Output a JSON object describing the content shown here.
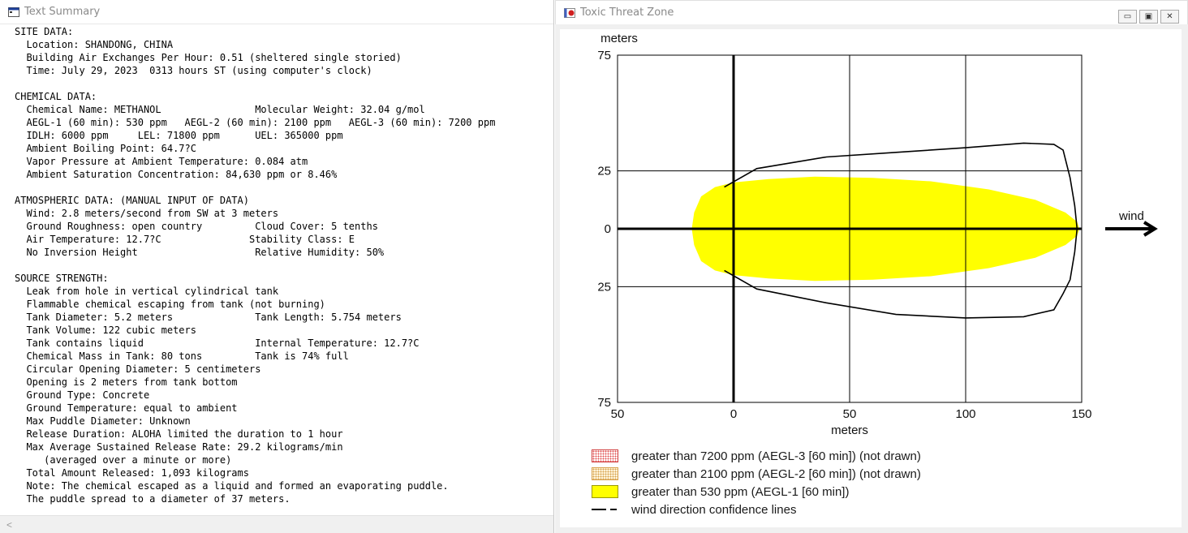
{
  "left_window": {
    "title": "Text Summary",
    "lines": [
      "SITE DATA:",
      "  Location: SHANDONG, CHINA",
      "  Building Air Exchanges Per Hour: 0.51 (sheltered single storied)",
      "  Time: July 29, 2023  0313 hours ST (using computer's clock)",
      "",
      "CHEMICAL DATA:",
      "  Chemical Name: METHANOL                Molecular Weight: 32.04 g/mol",
      "  AEGL-1 (60 min): 530 ppm   AEGL-2 (60 min): 2100 ppm   AEGL-3 (60 min): 7200 ppm",
      "  IDLH: 6000 ppm     LEL: 71800 ppm      UEL: 365000 ppm",
      "  Ambient Boiling Point: 64.7?C",
      "  Vapor Pressure at Ambient Temperature: 0.084 atm",
      "  Ambient Saturation Concentration: 84,630 ppm or 8.46%",
      "",
      "ATMOSPHERIC DATA: (MANUAL INPUT OF DATA)",
      "  Wind: 2.8 meters/second from SW at 3 meters",
      "  Ground Roughness: open country         Cloud Cover: 5 tenths",
      "  Air Temperature: 12.7?C               Stability Class: E",
      "  No Inversion Height                    Relative Humidity: 50%",
      "",
      "SOURCE STRENGTH:",
      "  Leak from hole in vertical cylindrical tank",
      "  Flammable chemical escaping from tank (not burning)",
      "  Tank Diameter: 5.2 meters              Tank Length: 5.754 meters",
      "  Tank Volume: 122 cubic meters",
      "  Tank contains liquid                   Internal Temperature: 12.7?C",
      "  Chemical Mass in Tank: 80 tons         Tank is 74% full",
      "  Circular Opening Diameter: 5 centimeters",
      "  Opening is 2 meters from tank bottom",
      "  Ground Type: Concrete",
      "  Ground Temperature: equal to ambient",
      "  Max Puddle Diameter: Unknown",
      "  Release Duration: ALOHA limited the duration to 1 hour",
      "  Max Average Sustained Release Rate: 29.2 kilograms/min",
      "     (averaged over a minute or more)",
      "  Total Amount Released: 1,093 kilograms",
      "  Note: The chemical escaped as a liquid and formed an evaporating puddle.",
      "  The puddle spread to a diameter of 37 meters."
    ],
    "scroll_left_glyph": "<"
  },
  "right_window": {
    "title": "Toxic Threat Zone",
    "controls": {
      "minimize": "▭",
      "restore": "▣",
      "close": "✕"
    },
    "wind_label": "wind",
    "legend": [
      {
        "kind": "aegl3",
        "label": "greater than 7200 ppm (AEGL-3 [60 min]) (not drawn)"
      },
      {
        "kind": "aegl2",
        "label": "greater than 2100 ppm (AEGL-2 [60 min]) (not drawn)"
      },
      {
        "kind": "aegl1",
        "label": "greater than 530 ppm (AEGL-1 [60 min])"
      },
      {
        "kind": "wind",
        "label": "wind direction confidence lines"
      }
    ]
  },
  "chart_data": {
    "type": "area",
    "xlabel": "meters",
    "ylabel": "meters",
    "xlim": [
      -50,
      150
    ],
    "ylim": [
      -75,
      75
    ],
    "x_ticks": [
      -50,
      0,
      50,
      100,
      150
    ],
    "x_tick_labels": [
      "50",
      "0",
      "50",
      "100",
      "150"
    ],
    "y_ticks": [
      75,
      25,
      0,
      -25,
      -75
    ],
    "y_tick_labels": [
      "75",
      "25",
      "0",
      "25",
      "75"
    ],
    "grid": true,
    "colors": {
      "aegl1": "#ffff00",
      "axis": "#000000",
      "grid": "#000000"
    },
    "series": [
      {
        "name": "greater than 530 ppm (AEGL-1 [60 min])",
        "x": [
          -18,
          -17,
          -14,
          -8,
          0,
          15,
          35,
          60,
          85,
          110,
          130,
          143,
          148,
          149,
          148,
          143,
          130,
          110,
          85,
          60,
          35,
          15,
          0,
          -8,
          -14,
          -17,
          -18
        ],
        "y": [
          0,
          7,
          14,
          18,
          20,
          21.5,
          22.5,
          22,
          20.5,
          17,
          12.5,
          7,
          3,
          0,
          -3,
          -7,
          -12.5,
          -17,
          -20.5,
          -22,
          -22.5,
          -21.5,
          -20,
          -18,
          -14,
          -7,
          0
        ]
      },
      {
        "name": "wind direction confidence lines",
        "x": [
          -4,
          10,
          40,
          70,
          100,
          125,
          138,
          142,
          145,
          147,
          148,
          147,
          145,
          142,
          138,
          125,
          100,
          70,
          40,
          10,
          -4
        ],
        "y": [
          18,
          26,
          31,
          33,
          35,
          37,
          36.5,
          34,
          22,
          10,
          0,
          -10,
          -22,
          -28,
          -35,
          -38,
          -38.5,
          -37,
          -32,
          -26,
          -18
        ]
      }
    ]
  }
}
